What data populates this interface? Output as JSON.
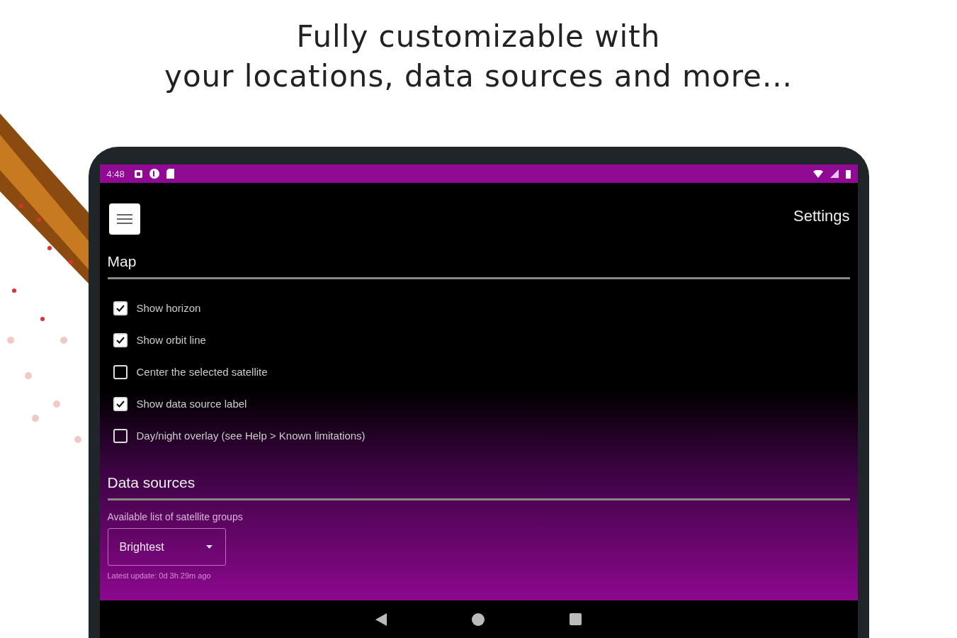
{
  "headline": "Fully customizable with\nyour locations, data sources and more...",
  "status_bar": {
    "time": "4:48"
  },
  "app_bar": {
    "title": "Settings"
  },
  "sections": [
    {
      "title": "Map",
      "items": [
        {
          "kind": "checkbox",
          "label": "Show horizon",
          "checked": true
        },
        {
          "kind": "checkbox",
          "label": "Show orbit line",
          "checked": true
        },
        {
          "kind": "checkbox",
          "label": "Center the selected satellite",
          "checked": false
        },
        {
          "kind": "checkbox",
          "label": "Show data source label",
          "checked": true
        },
        {
          "kind": "checkbox",
          "label": "Day/night overlay (see Help > Known limitations)",
          "checked": false
        }
      ]
    },
    {
      "title": "Data sources",
      "items": [
        {
          "kind": "dropdown",
          "label": "Available list of satellite groups",
          "value": "Brightest",
          "note": "Latest update: 0d 3h 29m ago"
        }
      ]
    }
  ]
}
